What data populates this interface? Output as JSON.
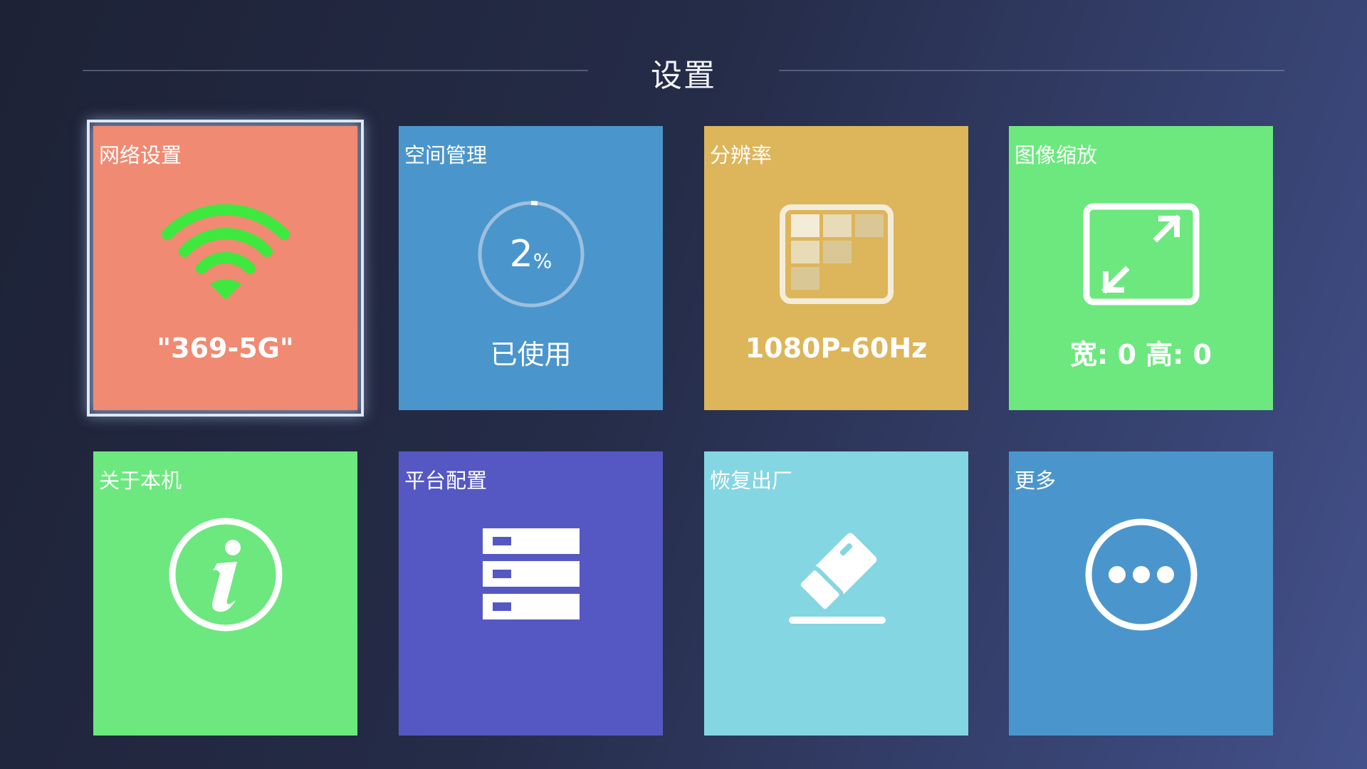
{
  "header": {
    "title": "设置"
  },
  "tiles": [
    {
      "label": "网络设置",
      "value": "\"369-5G\"",
      "color": "#f08a72",
      "icon": "wifi-icon"
    },
    {
      "label": "空间管理",
      "value": "已使用",
      "percent_number": "2",
      "percent_unit": "%",
      "usage_percent": 2,
      "color": "#4a96cc",
      "icon": "storage-ring-icon"
    },
    {
      "label": "分辨率",
      "value": "1080P-60Hz",
      "color": "#ddb55a",
      "icon": "resolution-grid-icon"
    },
    {
      "label": "图像缩放",
      "value": "宽: 0 高: 0",
      "color": "#6ce87e",
      "icon": "resize-arrows-icon"
    },
    {
      "label": "关于本机",
      "color": "#6ce87e",
      "icon": "info-icon"
    },
    {
      "label": "平台配置",
      "color": "#5558c2",
      "icon": "server-icon"
    },
    {
      "label": "恢复出厂",
      "color": "#84d6e2",
      "icon": "eraser-icon"
    },
    {
      "label": "更多",
      "color": "#4a96cc",
      "icon": "more-dots-icon"
    }
  ]
}
